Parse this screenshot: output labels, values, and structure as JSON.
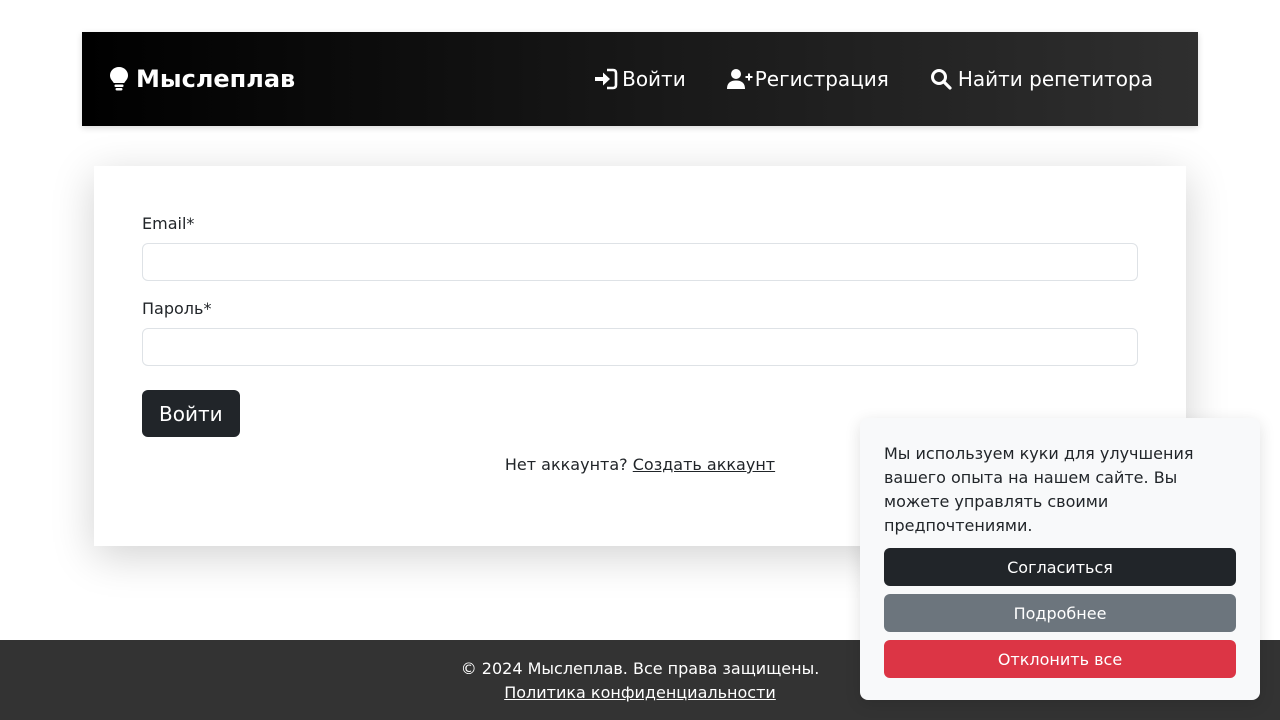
{
  "navbar": {
    "brand": "Мыслеплав",
    "links": [
      {
        "label": "Войти",
        "icon": "sign-in-icon"
      },
      {
        "label": "Регистрация",
        "icon": "user-plus-icon"
      },
      {
        "label": "Найти репетитора",
        "icon": "search-icon"
      }
    ]
  },
  "form": {
    "email_label": "Email*",
    "email_value": "",
    "password_label": "Пароль*",
    "password_value": "",
    "submit_label": "Войти",
    "no_account_text": "Нет аккаунта?",
    "create_account_link": "Создать аккаунт"
  },
  "footer": {
    "copyright": "© 2024 Мыслеплав. Все права защищены.",
    "privacy_link": "Политика конфиденциальности"
  },
  "cookie_banner": {
    "text": "Мы используем куки для улучшения вашего опыта на нашем сайте. Вы можете управлять своими предпочтениями.",
    "accept_label": "Согласиться",
    "more_label": "Подробнее",
    "reject_label": "Отклонить все"
  },
  "colors": {
    "primary_dark": "#212529",
    "secondary": "#6c757d",
    "danger": "#dc3545",
    "footer_bg": "#333333"
  }
}
